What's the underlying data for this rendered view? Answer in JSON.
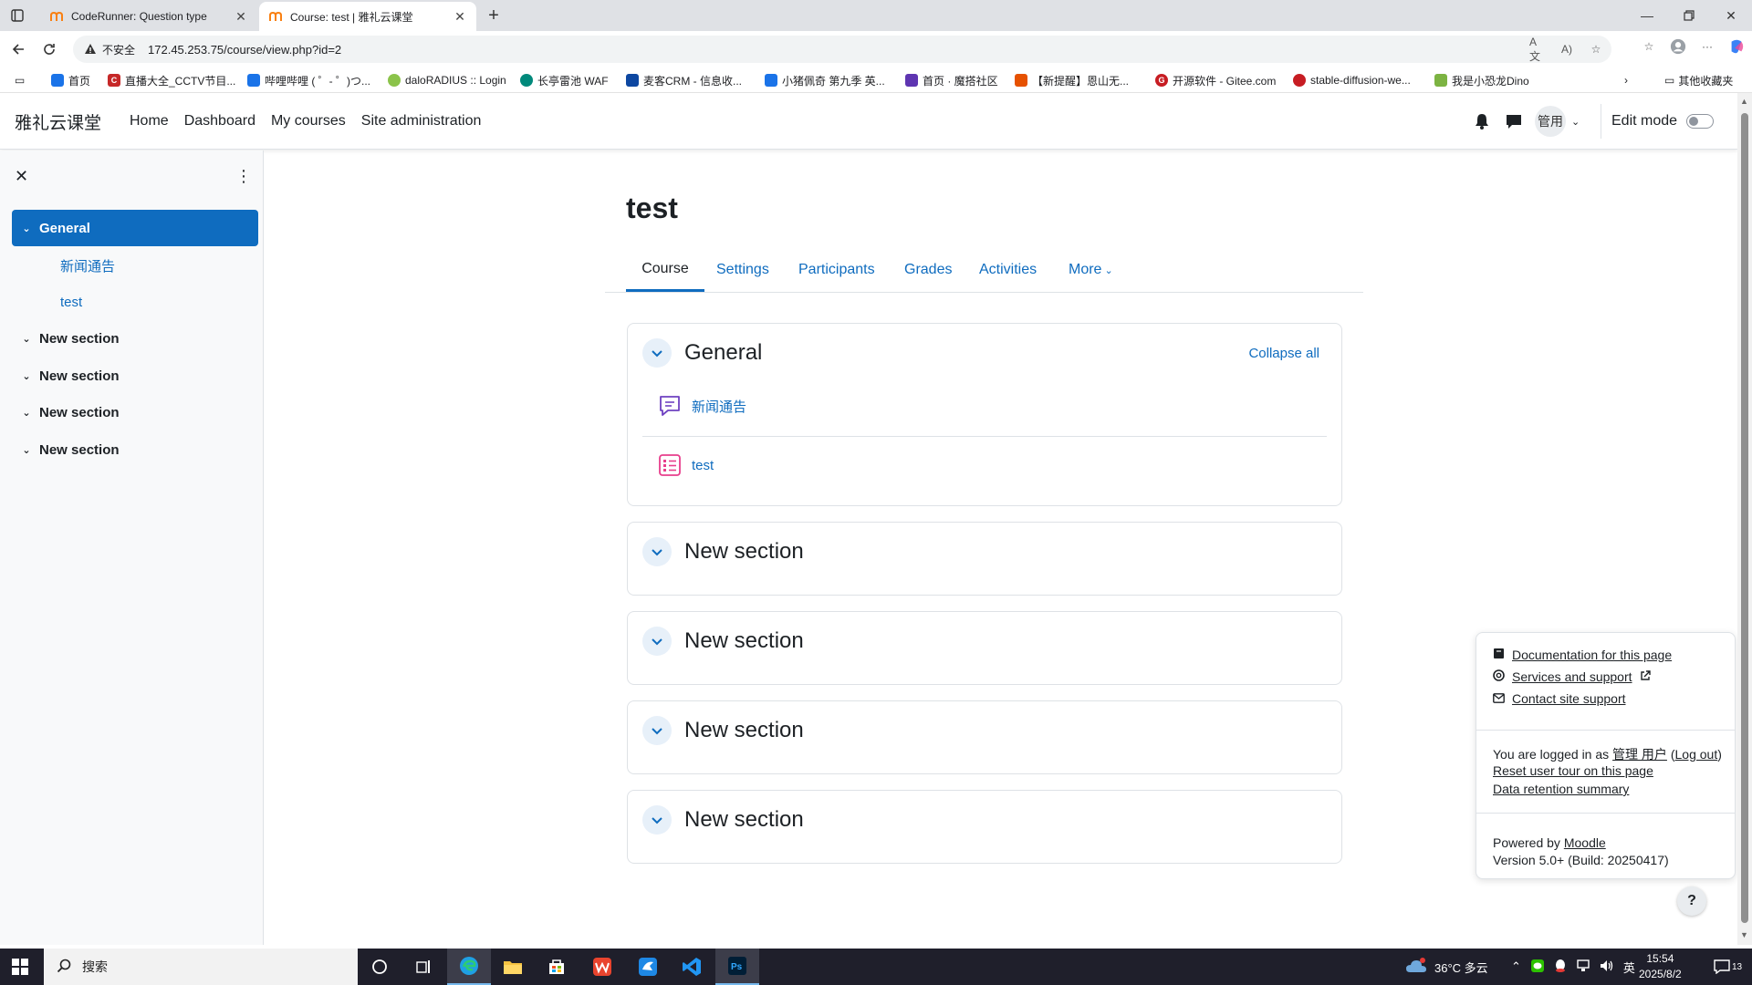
{
  "browser": {
    "tabs": [
      {
        "title": "CodeRunner: Question type"
      },
      {
        "title": "Course: test | 雅礼云课堂"
      }
    ],
    "security_label": "不安全",
    "url": "172.45.253.75/course/view.php?id=2",
    "bookmarks": [
      {
        "label": "首页",
        "color": "#1a73e8"
      },
      {
        "label": "直播大全_CCTV节目...",
        "color": "#c62828"
      },
      {
        "label": "哔哩哔哩 ( ゜- ゜)つ...",
        "color": "#1a73e8"
      },
      {
        "label": "daloRADIUS :: Login",
        "color": "#8bc34a"
      },
      {
        "label": "长亭雷池 WAF",
        "color": "#00897b"
      },
      {
        "label": "麦客CRM - 信息收...",
        "color": "#0d47a1"
      },
      {
        "label": "小猪佩奇 第九季 英...",
        "color": "#1a73e8"
      },
      {
        "label": "首页 · 魔搭社区",
        "color": "#5e35b1"
      },
      {
        "label": "【新提醒】恩山无...",
        "color": "#e65100"
      },
      {
        "label": "开源软件 - Gitee.com",
        "color": "#c71d23"
      },
      {
        "label": "stable-diffusion-we...",
        "color": "#c71d23"
      },
      {
        "label": "我是小恐龙Dino",
        "color": "#7cb342"
      }
    ],
    "other_bookmarks": "其他收藏夹"
  },
  "navbar": {
    "brand": "雅礼云课堂",
    "links": [
      "Home",
      "Dashboard",
      "My courses",
      "Site administration"
    ],
    "user_initials": "管用",
    "edit_mode": "Edit mode"
  },
  "course_index": {
    "items": [
      {
        "label": "General",
        "type": "section",
        "active": true
      },
      {
        "label": "新闻通告",
        "type": "activity"
      },
      {
        "label": "test",
        "type": "activity"
      },
      {
        "label": "New section",
        "type": "section"
      },
      {
        "label": "New section",
        "type": "section"
      },
      {
        "label": "New section",
        "type": "section"
      },
      {
        "label": "New section",
        "type": "section"
      }
    ]
  },
  "course": {
    "title": "test",
    "tabs": [
      "Course",
      "Settings",
      "Participants",
      "Grades",
      "Activities",
      "More"
    ],
    "collapse_all": "Collapse all",
    "sections": [
      {
        "name": "General",
        "activities": [
          {
            "name": "新闻通告",
            "icon": "forum-icon",
            "color": "#6f42c1"
          },
          {
            "name": "test",
            "icon": "quiz-icon",
            "color": "#e83e8c"
          }
        ]
      },
      {
        "name": "New section"
      },
      {
        "name": "New section"
      },
      {
        "name": "New section"
      },
      {
        "name": "New section"
      }
    ]
  },
  "footer": {
    "doc_link": "Documentation for this page",
    "services_link": "Services and support",
    "contact_link": "Contact site support",
    "logged_in_prefix": "You are logged in as",
    "user_name": "管理 用户",
    "logout": "Log out",
    "reset_tour": "Reset user tour on this page",
    "data_retention": "Data retention summary",
    "powered_by": "Powered by",
    "moodle": "Moodle",
    "version": "Version 5.0+ (Build: 20250417)",
    "help": "?"
  },
  "taskbar": {
    "search_placeholder": "搜索",
    "weather": "36°C 多云",
    "ime": "英",
    "time": "15:54",
    "date": "2025/8/2",
    "notifications": "13"
  },
  "colors": {
    "primary": "#0f6cbf",
    "drawer_bg": "#f8f9fa",
    "taskbar_bg": "#1f1f2b"
  }
}
